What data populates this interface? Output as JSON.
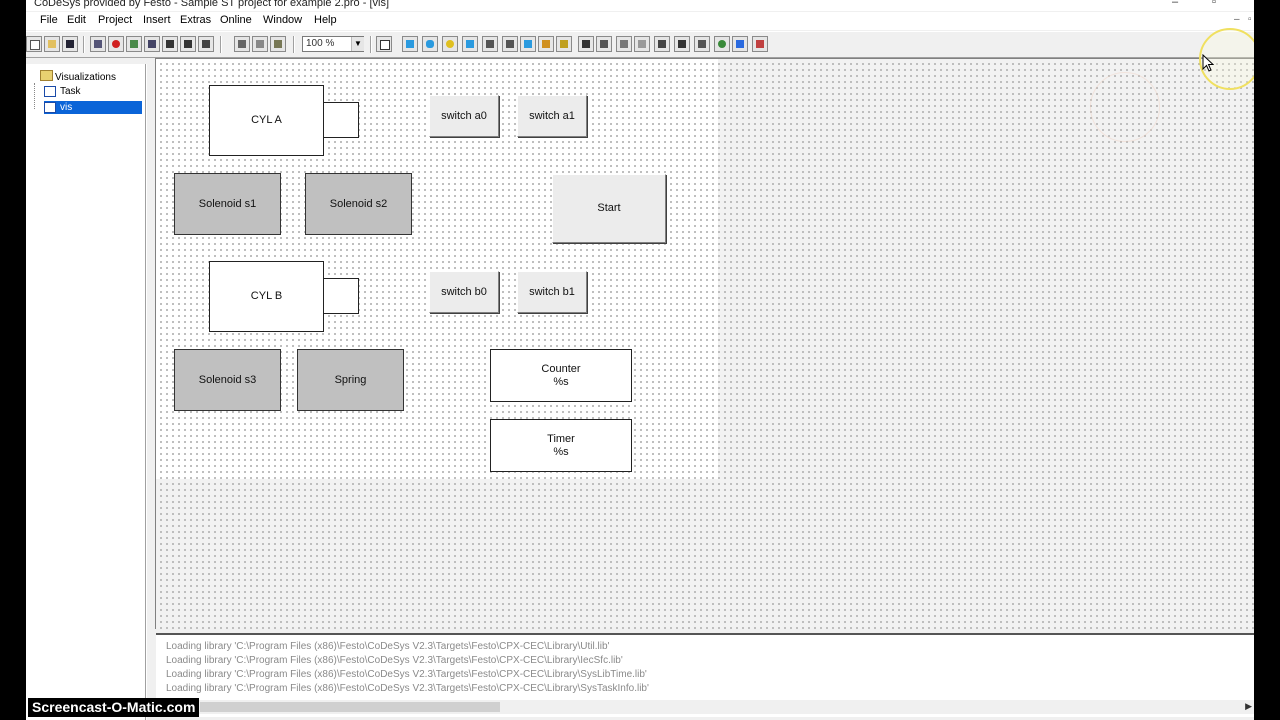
{
  "window": {
    "title": "CoDeSys provided by Festo - Sample ST project for example 2.pro - [vis]"
  },
  "menubar": {
    "items": [
      "File",
      "Edit",
      "Project",
      "Insert",
      "Extras",
      "Online",
      "Window",
      "Help"
    ]
  },
  "toolbar": {
    "zoom_value": "100 %",
    "icons": [
      "new-icon",
      "open-icon",
      "save-icon",
      "compile-icon",
      "stop-icon",
      "run-icon",
      "step-icon",
      "login-icon",
      "logout-icon",
      "cut-icon",
      "copy-icon",
      "paste-icon",
      "select-icon",
      "rectangle-icon",
      "rounded-rectangle-icon",
      "ellipse-icon",
      "polygon-icon",
      "polyline-icon",
      "curve-icon",
      "pie-icon",
      "bitmap-icon",
      "visualization-icon",
      "button-icon",
      "web-icon",
      "table-icon",
      "alarm-icon",
      "text-icon",
      "meter-icon",
      "trend-icon",
      "bar-icon",
      "histogram-icon"
    ]
  },
  "tree": {
    "root_label": "Visualizations",
    "children": [
      {
        "label": "Task",
        "selected": false
      },
      {
        "label": "vis",
        "selected": true
      }
    ]
  },
  "visualization": {
    "elements": {
      "cyl_a": "CYL A",
      "cyl_b": "CYL B",
      "switch_a0": "switch a0",
      "switch_a1": "switch a1",
      "switch_b0": "switch b0",
      "switch_b1": "switch b1",
      "solenoid_s1": "Solenoid s1",
      "solenoid_s2": "Solenoid s2",
      "solenoid_s3": "Solenoid s3",
      "spring": "Spring",
      "start": "Start",
      "counter": "Counter\n%s",
      "timer": "Timer\n%s"
    }
  },
  "messages": [
    "Loading library 'C:\\Program Files (x86)\\Festo\\CoDeSys V2.3\\Targets\\Festo\\CPX-CEC\\Library\\Util.lib'",
    "Loading library 'C:\\Program Files (x86)\\Festo\\CoDeSys V2.3\\Targets\\Festo\\CPX-CEC\\Library\\IecSfc.lib'",
    "Loading library 'C:\\Program Files (x86)\\Festo\\CoDeSys V2.3\\Targets\\Festo\\CPX-CEC\\Library\\SysLibTime.lib'",
    "Loading library 'C:\\Program Files (x86)\\Festo\\CoDeSys V2.3\\Targets\\Festo\\CPX-CEC\\Library\\SysTaskInfo.lib'"
  ],
  "watermark": "Screencast-O-Matic.com"
}
